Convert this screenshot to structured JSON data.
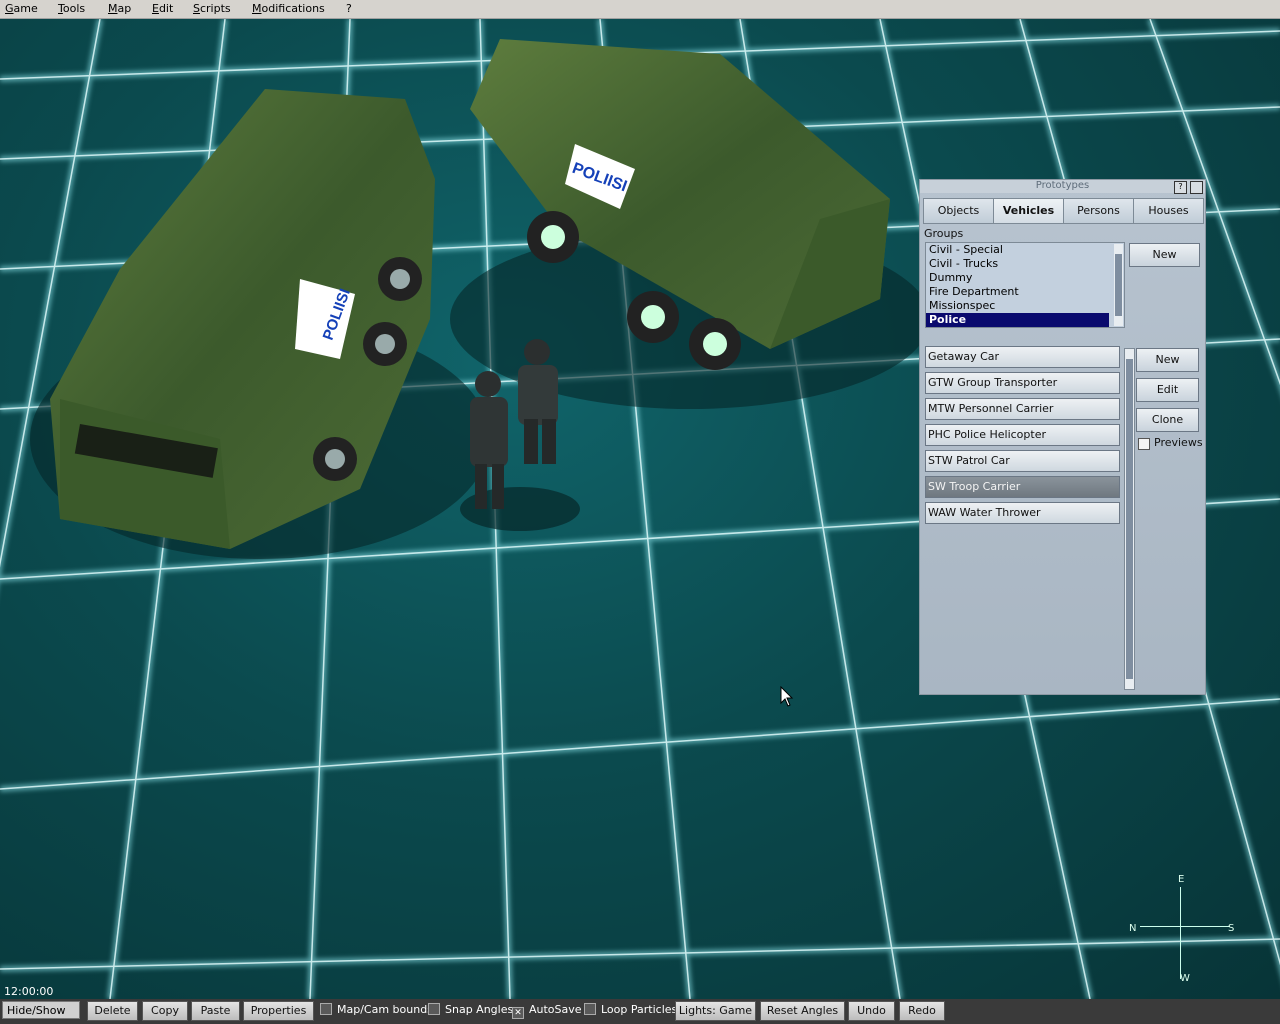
{
  "menu": [
    "Game",
    "Tools",
    "Map",
    "Edit",
    "Scripts",
    "Modifications",
    "?"
  ],
  "scene": {
    "vehicle_text": "POLIISI",
    "uniform_text": "POLIISI"
  },
  "panel": {
    "title": "Prototypes",
    "title_buttons": [
      "?",
      ""
    ],
    "tabs": [
      "Objects",
      "Vehicles",
      "Persons",
      "Houses"
    ],
    "active_tab": "Vehicles",
    "groups_label": "Groups",
    "groups": [
      "Civil - Special",
      "Civil - Trucks",
      "Dummy",
      "Fire Department",
      "Missionspec",
      "Police"
    ],
    "selected_group": "Police",
    "group_new_label": "New",
    "prototypes": [
      "Getaway Car",
      "GTW  Group Transporter",
      "MTW  Personnel Carrier",
      "PHC  Police Helicopter",
      "STW  Patrol Car",
      "SW   Troop Carrier",
      "WAW  Water Thrower"
    ],
    "selected_prototype": "SW   Troop Carrier",
    "buttons": {
      "new": "New",
      "edit": "Edit",
      "clone": "Clone"
    },
    "previews_label": "Previews"
  },
  "time": "12:00:00",
  "toolbar": {
    "hide_show": "Hide/Show",
    "delete": "Delete",
    "copy": "Copy",
    "paste": "Paste",
    "properties": "Properties",
    "map_cam_bounds": "Map/Cam bounds",
    "snap_angles": "Snap Angles",
    "autosave": "AutoSave",
    "autosave_checked": true,
    "loop_particles": "Loop Particles",
    "lights": "Lights: Game",
    "reset_angles": "Reset Angles",
    "undo": "Undo",
    "redo": "Redo"
  },
  "compass": {
    "e": "E",
    "n": "N",
    "s": "S",
    "w": "W"
  }
}
